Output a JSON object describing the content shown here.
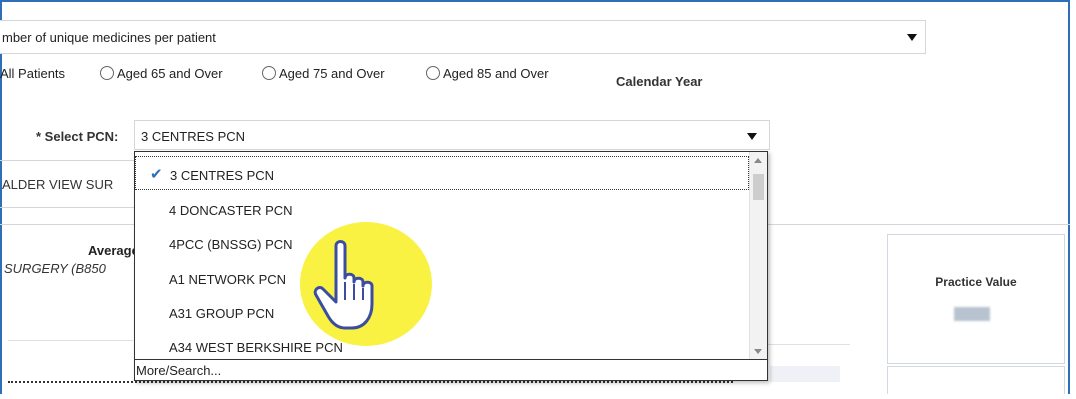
{
  "measure": {
    "selected": "mber of unique medicines per patient"
  },
  "patient_filter": {
    "options": [
      "All Patients",
      "Aged 65 and Over",
      "Aged 75 and Over",
      "Aged 85 and Over"
    ]
  },
  "period_label": "Calendar Year",
  "pcn": {
    "label": "* Select PCN:",
    "selected": "3 CENTRES PCN",
    "options": [
      "3 CENTRES PCN",
      "4 DONCASTER PCN",
      "4PCC (BNSSG) PCN",
      "A1 NETWORK PCN",
      "A31 GROUP PCN",
      "A34 WEST BERKSHIRE PCN"
    ],
    "more_search": "More/Search..."
  },
  "view_label": "ALDER VIEW SUR",
  "summary": {
    "average_label": "Average n",
    "surgery_label": "SURGERY (B850"
  },
  "practice_value_label": "Practice Value",
  "icons": {
    "check": "checkmark-icon",
    "cursor": "pointing-hand-cursor-icon",
    "caret": "caret-down-icon"
  },
  "colors": {
    "accent": "#2f6fb7",
    "highlight": "#f8f028"
  }
}
